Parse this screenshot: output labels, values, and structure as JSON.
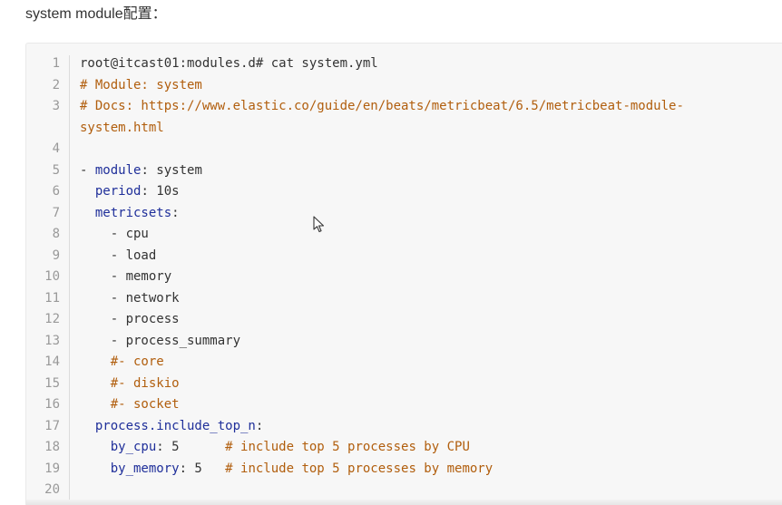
{
  "heading": "system module配置：",
  "code": {
    "lines": [
      {
        "num": "1",
        "tokens": [
          {
            "t": "root@itcast01:modules.d# cat system.yml",
            "c": "plain"
          }
        ]
      },
      {
        "num": "2",
        "tokens": [
          {
            "t": "# Module: system",
            "c": "comment"
          }
        ]
      },
      {
        "num": "3",
        "tokens": [
          {
            "t": "# Docs: https://www.elastic.co/guide/en/beats/metricbeat/6.5/metricbeat-module-",
            "c": "comment"
          }
        ]
      },
      {
        "num": "",
        "tokens": [
          {
            "t": "system.html",
            "c": "comment"
          }
        ]
      },
      {
        "num": "4",
        "tokens": []
      },
      {
        "num": "5",
        "tokens": [
          {
            "t": "- ",
            "c": "plain"
          },
          {
            "t": "module",
            "c": "key"
          },
          {
            "t": ": system",
            "c": "plain"
          }
        ]
      },
      {
        "num": "6",
        "tokens": [
          {
            "t": "  ",
            "c": "plain"
          },
          {
            "t": "period",
            "c": "key"
          },
          {
            "t": ": 10s",
            "c": "plain"
          }
        ]
      },
      {
        "num": "7",
        "tokens": [
          {
            "t": "  ",
            "c": "plain"
          },
          {
            "t": "metricsets",
            "c": "key"
          },
          {
            "t": ":",
            "c": "plain"
          }
        ]
      },
      {
        "num": "8",
        "tokens": [
          {
            "t": "    - cpu",
            "c": "plain"
          }
        ]
      },
      {
        "num": "9",
        "tokens": [
          {
            "t": "    - load",
            "c": "plain"
          }
        ]
      },
      {
        "num": "10",
        "tokens": [
          {
            "t": "    - memory",
            "c": "plain"
          }
        ]
      },
      {
        "num": "11",
        "tokens": [
          {
            "t": "    - network",
            "c": "plain"
          }
        ]
      },
      {
        "num": "12",
        "tokens": [
          {
            "t": "    - process",
            "c": "plain"
          }
        ]
      },
      {
        "num": "13",
        "tokens": [
          {
            "t": "    - process_summary",
            "c": "plain"
          }
        ]
      },
      {
        "num": "14",
        "tokens": [
          {
            "t": "    ",
            "c": "plain"
          },
          {
            "t": "#- core",
            "c": "comment"
          }
        ]
      },
      {
        "num": "15",
        "tokens": [
          {
            "t": "    ",
            "c": "plain"
          },
          {
            "t": "#- diskio",
            "c": "comment"
          }
        ]
      },
      {
        "num": "16",
        "tokens": [
          {
            "t": "    ",
            "c": "plain"
          },
          {
            "t": "#- socket",
            "c": "comment"
          }
        ]
      },
      {
        "num": "17",
        "tokens": [
          {
            "t": "  ",
            "c": "plain"
          },
          {
            "t": "process.include_top_n",
            "c": "key"
          },
          {
            "t": ":",
            "c": "plain"
          }
        ]
      },
      {
        "num": "18",
        "tokens": [
          {
            "t": "    ",
            "c": "plain"
          },
          {
            "t": "by_cpu",
            "c": "key"
          },
          {
            "t": ": 5      ",
            "c": "plain"
          },
          {
            "t": "# include top 5 processes by CPU",
            "c": "comment"
          }
        ]
      },
      {
        "num": "19",
        "tokens": [
          {
            "t": "    ",
            "c": "plain"
          },
          {
            "t": "by_memory",
            "c": "key"
          },
          {
            "t": ": 5   ",
            "c": "plain"
          },
          {
            "t": "# include top 5 processes by memory",
            "c": "comment"
          }
        ]
      },
      {
        "num": "20",
        "tokens": []
      }
    ]
  },
  "icons": {
    "cursor": "mouse-pointer-icon"
  },
  "colors": {
    "comment": "#b15e0d",
    "key": "#1f2f9a",
    "plain": "#333333",
    "line_number": "#999999",
    "code_background": "#f7f7f7"
  }
}
